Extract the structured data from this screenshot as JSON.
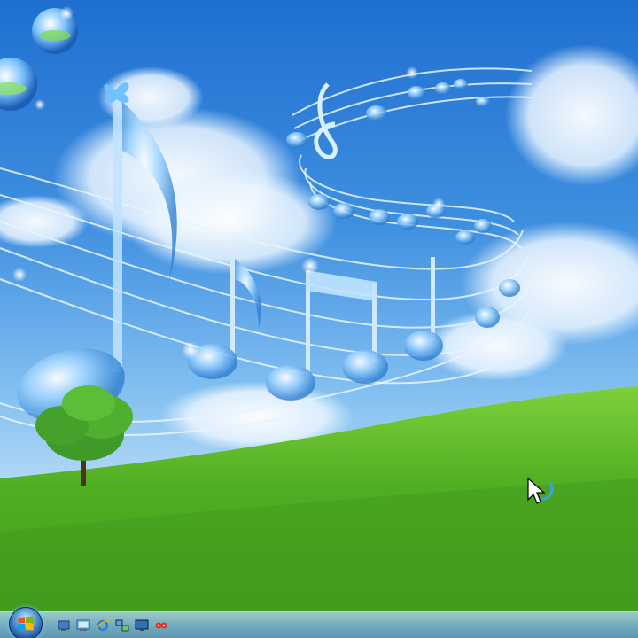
{
  "desktop": {
    "wallpaper_icon": "music-notes-sky-meadow",
    "colors": {
      "sky_top": "#1f6fd0",
      "grass": "#4caf2a",
      "taskbar": "#7fb4d2"
    }
  },
  "taskbar": {
    "start_icon": "windows-logo",
    "quick_launch": [
      "show-desktop-icon",
      "computer-icon",
      "internet-explorer-icon",
      "network-icon",
      "display-icon",
      "media-icon"
    ]
  },
  "cursor": {
    "icon": "arrow-busy-cursor"
  }
}
